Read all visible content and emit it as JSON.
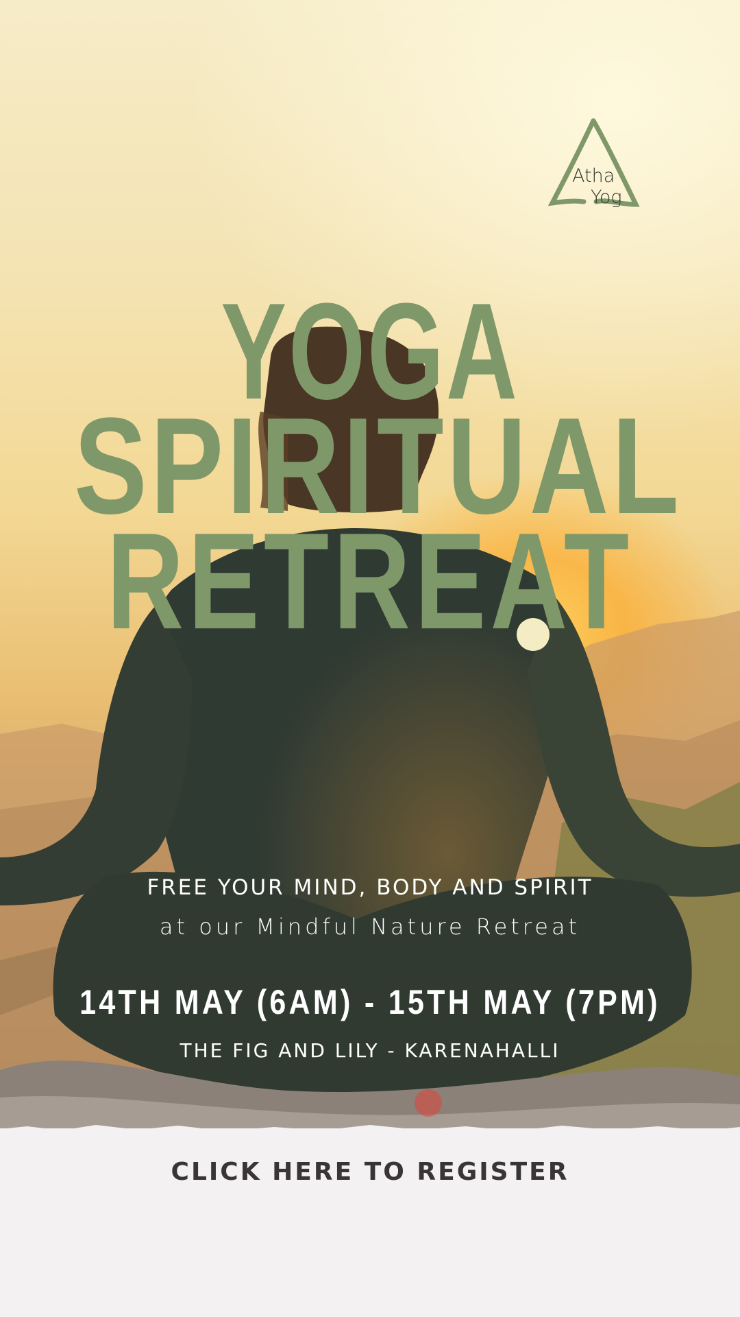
{
  "logo": {
    "line1": "Atha",
    "line2": "Yog",
    "color": "#7f986a"
  },
  "title": {
    "line1": "YOGA",
    "line2": "SPIRITUAL",
    "line3": "RETREAT",
    "color": "#7f986a"
  },
  "tagline": {
    "line1": "FREE YOUR MIND, BODY AND SPIRIT",
    "line2": "at our Mindful Nature Retreat"
  },
  "event": {
    "dates": "14TH MAY (6AM) - 15TH MAY (7PM)",
    "venue": "THE FIG AND LILY - KARENAHALLI"
  },
  "cta": {
    "label": "CLICK HERE TO REGISTER",
    "color": "#3a3535"
  }
}
